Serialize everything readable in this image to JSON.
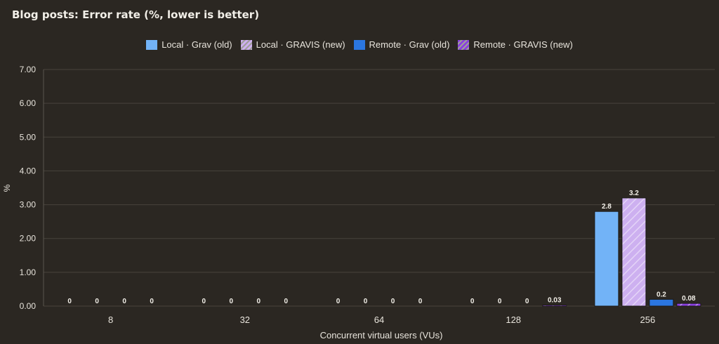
{
  "chart_data": {
    "type": "bar",
    "title": "Blog posts: Error rate (%, lower is better)",
    "xlabel": "Concurrent virtual users (VUs)",
    "ylabel": "%",
    "ylim": [
      0,
      7
    ],
    "yticks": [
      "0.00",
      "1.00",
      "2.00",
      "3.00",
      "4.00",
      "5.00",
      "6.00",
      "7.00"
    ],
    "categories": [
      "8",
      "32",
      "64",
      "128",
      "256"
    ],
    "grid": true,
    "legend_position": "top",
    "series": [
      {
        "name": "Local · Grav (old)",
        "color": "#72b3f7",
        "pattern": "solid",
        "values": [
          0,
          0,
          0,
          0,
          2.8
        ],
        "labels": [
          "0",
          "0",
          "0",
          "0",
          "2.8"
        ]
      },
      {
        "name": "Local · GRAVIS (new)",
        "color": "#cdb0f0",
        "pattern": "hatched",
        "values": [
          0,
          0,
          0,
          0,
          3.2
        ],
        "labels": [
          "0",
          "0",
          "0",
          "0",
          "3.2"
        ]
      },
      {
        "name": "Remote · Grav (old)",
        "color": "#2b76e0",
        "pattern": "solid",
        "values": [
          0,
          0,
          0,
          0,
          0.2
        ],
        "labels": [
          "0",
          "0",
          "0",
          "0",
          "0.2"
        ]
      },
      {
        "name": "Remote · GRAVIS (new)",
        "color": "#8a3fe0",
        "pattern": "hatched",
        "values": [
          0,
          0,
          0,
          0.03,
          0.08
        ],
        "labels": [
          "0",
          "0",
          "0",
          "0.03",
          "0.08"
        ]
      }
    ]
  }
}
